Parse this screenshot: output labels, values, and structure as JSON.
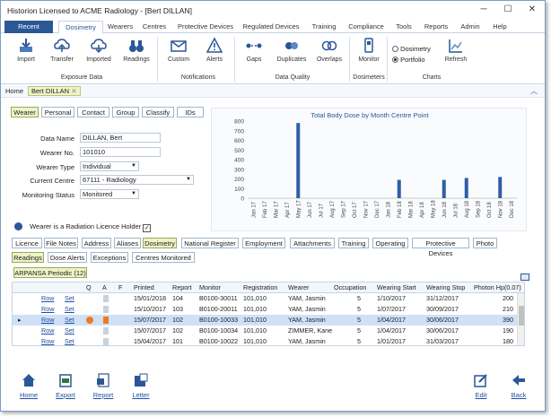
{
  "window": {
    "title": "Historion Licensed to ACME Radiology - [Bert DILLAN]",
    "minimize": "─",
    "maximize": "☐",
    "close": "✕"
  },
  "menu": {
    "recent": "Recent",
    "tabs": [
      "Dosimetry",
      "Wearers",
      "Centres",
      "Protective Devices",
      "Regulated Devices",
      "Training",
      "Compliance",
      "Tools",
      "Reports",
      "Admin",
      "Help"
    ]
  },
  "ribbon": {
    "import": "Import",
    "transfer": "Transfer",
    "imported": "Imported",
    "readings": "Readings",
    "custom": "Custom",
    "alerts": "Alerts",
    "gaps": "Gaps",
    "duplicates": "Duplicates",
    "overlaps": "Overlaps",
    "monitor": "Monitor",
    "dosimetry_opt": "Dosimetry",
    "portfolio_opt": "Portfolio",
    "refresh": "Refresh",
    "groups": {
      "exposure": "Exposure Data",
      "notifications": "Notifications",
      "quality": "Data Quality",
      "dosimeters": "Dosimeters",
      "charts": "Charts"
    }
  },
  "breadcrumb": {
    "home": "Home",
    "current": "Bert DILLAN"
  },
  "subtabs": [
    "Wearer",
    "Personal",
    "Contact",
    "Group",
    "Classify",
    "IDs"
  ],
  "form": {
    "data_name_label": "Data Name",
    "data_name": "DILLAN, Bert",
    "wearer_no_label": "Wearer No.",
    "wearer_no": "101010",
    "wearer_type_label": "Wearer Type",
    "wearer_type": "Individual",
    "centre_label": "Current Centre",
    "centre": "67111 - Radiology",
    "status_label": "Monitoring Status",
    "status": "Monitored",
    "licence_holder": "Wearer is a Radiation Licence Holder"
  },
  "chart_data": {
    "type": "bar",
    "title": "Total Body Dose by Month Centre Point",
    "categories": [
      "Jan 17",
      "Feb 17",
      "Mar 17",
      "Apr 17",
      "May 17",
      "Jun 17",
      "Jul 17",
      "Aug 17",
      "Sep 17",
      "Oct 17",
      "Nov 17",
      "Dec 17",
      "Jan 18",
      "Feb 18",
      "Mar 18",
      "Apr 18",
      "May 18",
      "Jun 18",
      "Jul 18",
      "Aug 18",
      "Sep 18",
      "Oct 18",
      "Nov 18",
      "Dec 18"
    ],
    "values": [
      0,
      0,
      0,
      0,
      780,
      0,
      0,
      0,
      0,
      0,
      0,
      0,
      0,
      190,
      0,
      0,
      0,
      190,
      0,
      210,
      0,
      0,
      220,
      0
    ],
    "yticks": [
      "0",
      "100",
      "200",
      "300",
      "400",
      "500",
      "600",
      "700",
      "800"
    ],
    "ylim": [
      0,
      800
    ],
    "color": "#2e5fa8"
  },
  "bottom_tabs": [
    "Licence",
    "File Notes",
    "Address",
    "Aliases",
    "Dosimetry",
    "National Register",
    "Employment",
    "Attachments",
    "Training",
    "Operating",
    "Protective Devices",
    "Photo"
  ],
  "reading_tabs": [
    "Readings",
    "Dose Alerts",
    "Exceptions",
    "Centres Monitored"
  ],
  "group_tab": "ARPANSA Periodic (12)",
  "grid": {
    "headers": [
      "Q",
      "A",
      "F",
      "Printed",
      "Report",
      "Monitor",
      "Registration",
      "Wearer",
      "Occupation",
      "Wearing Start",
      "Wearing Stop",
      "Photon Hp(0.07)"
    ],
    "rows": [
      {
        "row": "Row",
        "set": "Set",
        "printed": "15/01/2018",
        "report": "104",
        "monitor": "B0100-30011",
        "reg": "101,010",
        "wearer": "YAM, Jasmin",
        "occ": "5",
        "start": "1/10/2017",
        "stop": "31/12/2017",
        "photon": "200"
      },
      {
        "row": "Row",
        "set": "Set",
        "printed": "15/10/2017",
        "report": "103",
        "monitor": "B0100-20011",
        "reg": "101,010",
        "wearer": "YAM, Jasmin",
        "occ": "5",
        "start": "1/07/2017",
        "stop": "30/09/2017",
        "photon": "210"
      },
      {
        "row": "Row",
        "set": "Set",
        "printed": "15/07/2017",
        "report": "102",
        "monitor": "B0100-10033",
        "reg": "101,010",
        "wearer": "YAM, Jasmin",
        "occ": "5",
        "start": "1/04/2017",
        "stop": "30/06/2017",
        "photon": "390"
      },
      {
        "row": "Row",
        "set": "Set",
        "printed": "15/07/2017",
        "report": "102",
        "monitor": "B0100-10034",
        "reg": "101,010",
        "wearer": "ZIMMER, Kane",
        "occ": "5",
        "start": "1/04/2017",
        "stop": "30/06/2017",
        "photon": "190"
      },
      {
        "row": "Row",
        "set": "Set",
        "printed": "15/04/2017",
        "report": "101",
        "monitor": "B0100-10022",
        "reg": "101,010",
        "wearer": "YAM, Jasmin",
        "occ": "5",
        "start": "1/01/2017",
        "stop": "31/03/2017",
        "photon": "180"
      }
    ]
  },
  "footer": {
    "home": "Home",
    "export": "Export",
    "report": "Report",
    "letter": "Letter",
    "edit": "Edit",
    "back": "Back"
  }
}
